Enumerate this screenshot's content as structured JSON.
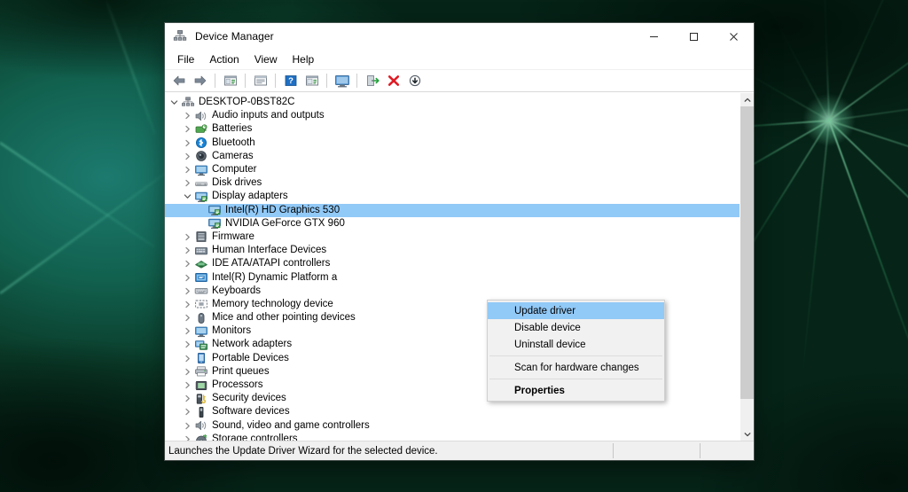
{
  "window": {
    "title": "Device Manager",
    "title_icon": "device-manager-icon",
    "controls": {
      "minimize": "─",
      "maximize": "□",
      "close": "✕"
    }
  },
  "menubar": {
    "items": [
      {
        "label": "File"
      },
      {
        "label": "Action"
      },
      {
        "label": "View"
      },
      {
        "label": "Help"
      }
    ]
  },
  "toolbar": {
    "buttons": [
      {
        "name": "back-button",
        "icon": "back-arrow-icon"
      },
      {
        "name": "forward-button",
        "icon": "forward-arrow-icon"
      },
      {
        "name": "separator-1",
        "icon": "separator"
      },
      {
        "name": "show-hide-console-tree-button",
        "icon": "console-tree-icon"
      },
      {
        "name": "separator-2",
        "icon": "separator"
      },
      {
        "name": "properties-button",
        "icon": "properties-window-icon"
      },
      {
        "name": "separator-3",
        "icon": "separator"
      },
      {
        "name": "help-button",
        "icon": "help-question-icon"
      },
      {
        "name": "show-hide-action-pane-button",
        "icon": "action-pane-icon"
      },
      {
        "name": "separator-4",
        "icon": "separator"
      },
      {
        "name": "scan-hardware-changes-button",
        "icon": "monitor-scan-icon"
      },
      {
        "name": "separator-5",
        "icon": "separator"
      },
      {
        "name": "update-driver-button",
        "icon": "update-driver-icon"
      },
      {
        "name": "uninstall-device-button",
        "icon": "red-x-icon"
      },
      {
        "name": "disable-device-button",
        "icon": "disable-down-arrow-icon"
      }
    ]
  },
  "tree": {
    "root": {
      "label": "DESKTOP-0BST82C",
      "icon": "computer-tree-icon",
      "expanded": true,
      "indent": 0
    },
    "items": [
      {
        "label": "Audio inputs and outputs",
        "icon": "speaker-icon",
        "indent": 1,
        "expandable": true,
        "expanded": false
      },
      {
        "label": "Batteries",
        "icon": "battery-icon",
        "indent": 1,
        "expandable": true,
        "expanded": false
      },
      {
        "label": "Bluetooth",
        "icon": "bluetooth-icon",
        "indent": 1,
        "expandable": true,
        "expanded": false
      },
      {
        "label": "Cameras",
        "icon": "camera-icon",
        "indent": 1,
        "expandable": true,
        "expanded": false
      },
      {
        "label": "Computer",
        "icon": "computer-icon",
        "indent": 1,
        "expandable": true,
        "expanded": false
      },
      {
        "label": "Disk drives",
        "icon": "disk-drive-icon",
        "indent": 1,
        "expandable": true,
        "expanded": false
      },
      {
        "label": "Display adapters",
        "icon": "display-adapter-icon",
        "indent": 1,
        "expandable": true,
        "expanded": true
      },
      {
        "label": "Intel(R) HD Graphics 530",
        "icon": "display-adapter-icon",
        "indent": 2,
        "expandable": false,
        "selected": true
      },
      {
        "label": "NVIDIA GeForce GTX 960",
        "icon": "display-adapter-icon",
        "indent": 2,
        "expandable": false
      },
      {
        "label": "Firmware",
        "icon": "firmware-icon",
        "indent": 1,
        "expandable": true,
        "expanded": false
      },
      {
        "label": "Human Interface Devices",
        "icon": "hid-icon",
        "indent": 1,
        "expandable": true,
        "expanded": false
      },
      {
        "label": "IDE ATA/ATAPI controllers",
        "icon": "ide-controller-icon",
        "indent": 1,
        "expandable": true,
        "expanded": false
      },
      {
        "label": "Intel(R) Dynamic Platform a",
        "icon": "intel-platform-icon",
        "indent": 1,
        "expandable": true,
        "expanded": false
      },
      {
        "label": "Keyboards",
        "icon": "keyboard-icon",
        "indent": 1,
        "expandable": true,
        "expanded": false
      },
      {
        "label": "Memory technology device",
        "icon": "memory-device-icon",
        "indent": 1,
        "expandable": true,
        "expanded": false
      },
      {
        "label": "Mice and other pointing devices",
        "icon": "mouse-icon",
        "indent": 1,
        "expandable": true,
        "expanded": false
      },
      {
        "label": "Monitors",
        "icon": "monitor-icon",
        "indent": 1,
        "expandable": true,
        "expanded": false
      },
      {
        "label": "Network adapters",
        "icon": "network-adapter-icon",
        "indent": 1,
        "expandable": true,
        "expanded": false
      },
      {
        "label": "Portable Devices",
        "icon": "portable-device-icon",
        "indent": 1,
        "expandable": true,
        "expanded": false
      },
      {
        "label": "Print queues",
        "icon": "printer-icon",
        "indent": 1,
        "expandable": true,
        "expanded": false
      },
      {
        "label": "Processors",
        "icon": "processor-icon",
        "indent": 1,
        "expandable": true,
        "expanded": false
      },
      {
        "label": "Security devices",
        "icon": "security-device-icon",
        "indent": 1,
        "expandable": true,
        "expanded": false
      },
      {
        "label": "Software devices",
        "icon": "software-device-icon",
        "indent": 1,
        "expandable": true,
        "expanded": false
      },
      {
        "label": "Sound, video and game controllers",
        "icon": "sound-controller-icon",
        "indent": 1,
        "expandable": true,
        "expanded": false
      },
      {
        "label": "Storage controllers",
        "icon": "storage-controller-icon",
        "indent": 1,
        "expandable": true,
        "expanded": false
      }
    ]
  },
  "context_menu": {
    "items": [
      {
        "label": "Update driver",
        "selected": true,
        "bold": false
      },
      {
        "label": "Disable device",
        "selected": false,
        "bold": false
      },
      {
        "label": "Uninstall device",
        "selected": false,
        "bold": false
      },
      {
        "separator": true
      },
      {
        "label": "Scan for hardware changes",
        "selected": false,
        "bold": false
      },
      {
        "separator": true
      },
      {
        "label": "Properties",
        "selected": false,
        "bold": true
      }
    ]
  },
  "statusbar": {
    "text": "Launches the Update Driver Wizard for the selected device."
  },
  "colors": {
    "selection_blue": "#91c9f7",
    "window_bg": "#ffffff",
    "chrome_gray": "#f0f0f0",
    "desktop_green": "#07351f"
  }
}
